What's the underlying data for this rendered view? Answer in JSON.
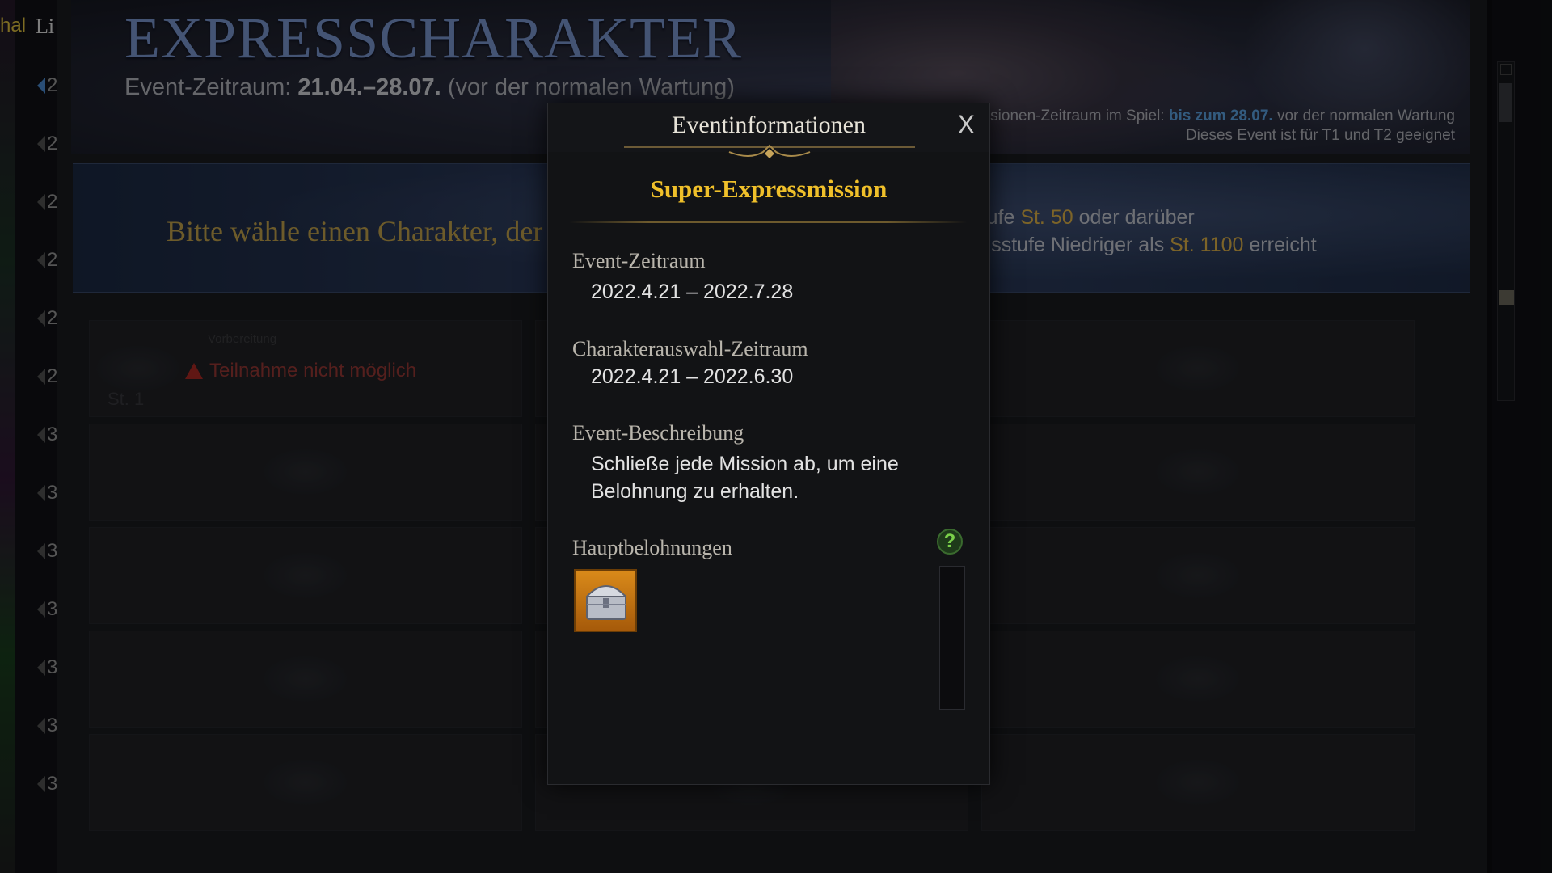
{
  "left_strip": {
    "tab_label_highlight": "hal",
    "tab_label": "Li",
    "numbers": [
      "2",
      "2",
      "2",
      "2",
      "2",
      "2",
      "3",
      "3",
      "3",
      "3",
      "3",
      "3",
      "3"
    ]
  },
  "header": {
    "title": "EXPRESSCHARAKTER",
    "period_prefix": "Event-Zeitraum:",
    "period_dates": "21.04.–28.07.",
    "period_suffix": "(vor der normalen Wartung)",
    "info_line1_prefix": "Missionen-Zeitraum im Spiel:",
    "info_line1_highlight": "bis zum 28.07.",
    "info_line1_suffix": "vor der normalen Wartung",
    "info_line2": "Dieses Event ist für T1 und T2 geeignet"
  },
  "banner": {
    "prompt": "Bitte wähle einen Charakter, der an der",
    "req1_prefix": "Erreichte Stufe",
    "req1_value": "St. 50",
    "req1_suffix": "oder darüber",
    "req2_prefix": "Gegenstandsstufe Niedriger als",
    "req2_value": "St. 1100",
    "req2_suffix": "erreicht"
  },
  "slots": {
    "first": {
      "small_label": "Vorbereitung",
      "status": "Teilnahme nicht möglich",
      "level": "St. 1"
    }
  },
  "modal": {
    "title": "Eventinformationen",
    "close_label": "X",
    "subtitle": "Super-Expressmission",
    "sections": [
      {
        "heading": "Event-Zeitraum",
        "value": "2022.4.21 – 2022.7.28"
      },
      {
        "heading": "Charakterauswahl-Zeitraum",
        "value": "2022.4.21 – 2022.6.30"
      },
      {
        "heading": "Event-Beschreibung",
        "value_line1": "Schließe jede Mission ab, um eine",
        "value_line2": "Belohnung zu erhalten."
      },
      {
        "heading": "Hauptbelohnungen"
      }
    ],
    "help_label": "?",
    "reward_icon": "treasure-chest-icon"
  },
  "colors": {
    "title_blue": "#7d9ad4",
    "gold": "#f0c02a",
    "highlight_blue": "#5ea6e8",
    "warning_red": "#b02a26"
  }
}
